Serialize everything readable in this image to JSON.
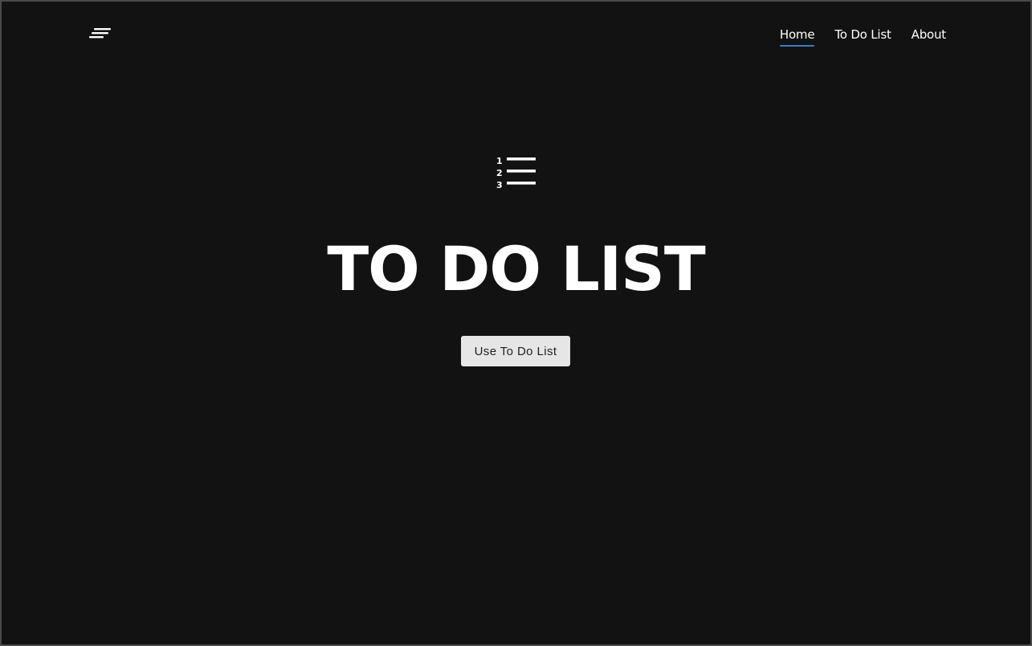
{
  "header": {
    "menu_icon": "hamburger-menu-icon",
    "nav": [
      {
        "label": "Home",
        "active": true
      },
      {
        "label": "To Do List",
        "active": false
      },
      {
        "label": "About",
        "active": false
      }
    ]
  },
  "hero": {
    "icon": "numbered-list-icon",
    "icon_digits": [
      "1",
      "2",
      "3"
    ],
    "title": "TO DO LIST",
    "button_label": "Use To Do List"
  },
  "colors": {
    "background": "#121212",
    "text": "#ffffff",
    "accent": "#2f7fd6",
    "button_bg": "#e6e6e6",
    "button_text": "#222222"
  }
}
